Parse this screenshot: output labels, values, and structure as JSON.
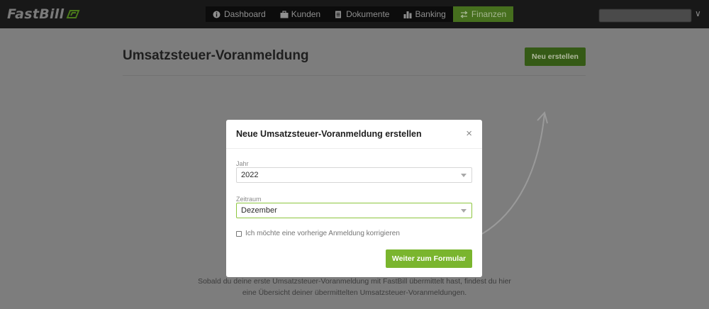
{
  "app": {
    "logo_text": "FastBill"
  },
  "nav": {
    "items": [
      {
        "label": "Dashboard",
        "icon": "info-icon"
      },
      {
        "label": "Kunden",
        "icon": "briefcase-icon"
      },
      {
        "label": "Dokumente",
        "icon": "document-icon"
      },
      {
        "label": "Banking",
        "icon": "bar-chart-icon"
      },
      {
        "label": "Finanzen",
        "icon": "transfer-icon",
        "active": true
      }
    ]
  },
  "user": {
    "chevron": "∨"
  },
  "page": {
    "title": "Umsatzsteuer-Voranmeldung",
    "new_button": "Neu erstellen",
    "empty_text_line1": "Sobald du deine erste Umsatzsteuer-Voranmeldung mit FastBill übermittelt hast, findest du hier",
    "empty_text_line2": "eine Übersicht deiner übermittelten Umsatzsteuer-Voranmeldungen."
  },
  "modal": {
    "title": "Neue Umsatzsteuer-Voranmeldung erstellen",
    "close": "×",
    "year_label": "Jahr",
    "year_value": "2022",
    "period_label": "Zeitraum",
    "period_value": "Dezember",
    "checkbox_label": "Ich möchte eine vorherige Anmeldung korrigieren",
    "submit": "Weiter zum Formular"
  },
  "colors": {
    "accent_green": "#7ab52e",
    "topbar": "#181818",
    "overlay": "#7d7d7d"
  }
}
